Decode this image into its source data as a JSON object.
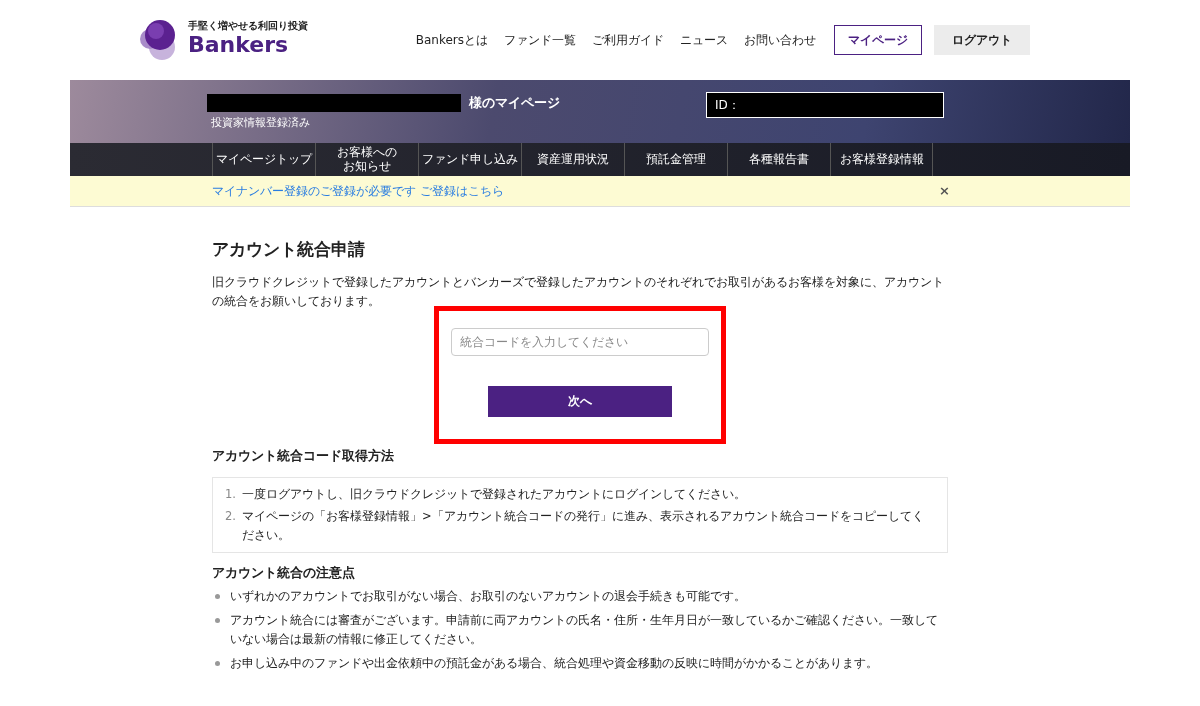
{
  "header": {
    "logo": {
      "tagline": "手堅く増やせる利回り投資",
      "name": "Bankers"
    },
    "nav": [
      {
        "label": "Bankersとは",
        "kind": "link"
      },
      {
        "label": "ファンド一覧",
        "kind": "link"
      },
      {
        "label": "ご利用ガイド",
        "kind": "link"
      },
      {
        "label": "ニュース",
        "kind": "link"
      },
      {
        "label": "お問い合わせ",
        "kind": "link"
      },
      {
        "label": "マイページ",
        "kind": "outline"
      },
      {
        "label": "ログアウト",
        "kind": "gray"
      }
    ]
  },
  "banner": {
    "title_suffix": "様のマイページ",
    "status": "投資家情報登録済み",
    "id_label": "ID："
  },
  "subnav": [
    {
      "lines": [
        "マイページトップ"
      ]
    },
    {
      "lines": [
        "お客様への",
        "お知らせ"
      ]
    },
    {
      "lines": [
        "ファンド申し込み"
      ]
    },
    {
      "lines": [
        "資産運用状況"
      ]
    },
    {
      "lines": [
        "預託金管理"
      ]
    },
    {
      "lines": [
        "各種報告書"
      ]
    },
    {
      "lines": [
        "お客様登録情報"
      ]
    }
  ],
  "alert": {
    "message": "マイナンバー登録のご登録が必要です",
    "link": "ご登録はこちら",
    "close": "×"
  },
  "main": {
    "title": "アカウント統合申請",
    "intro": "旧クラウドクレジットで登録したアカウントとバンカーズで登録したアカウントのそれぞれでお取引があるお客様を対象に、アカウントの統合をお願いしております。",
    "code_field": {
      "placeholder": "統合コードを入力してください"
    },
    "next_button": "次へ",
    "howto": {
      "title": "アカウント統合コード取得方法",
      "steps": [
        {
          "number": "1.",
          "text": "一度ログアウトし、旧クラウドクレジットで登録されたアカウントにログインしてください。"
        },
        {
          "number": "2.",
          "text": "マイページの「お客様登録情報」>「アカウント統合コードの発行」に進み、表示されるアカウント統合コードをコピーしてください。"
        }
      ]
    },
    "notes": {
      "title": "アカウント統合の注意点",
      "items": [
        "いずれかのアカウントでお取引がない場合、お取引のないアカウントの退会手続きも可能です。",
        "アカウント統合には審査がございます。申請前に両アカウントの氏名・住所・生年月日が一致しているかご確認ください。一致していない場合は最新の情報に修正してください。",
        "お申し込み中のファンドや出金依頼中の預託金がある場合、統合処理や資金移動の反映に時間がかかることがあります。"
      ]
    }
  }
}
